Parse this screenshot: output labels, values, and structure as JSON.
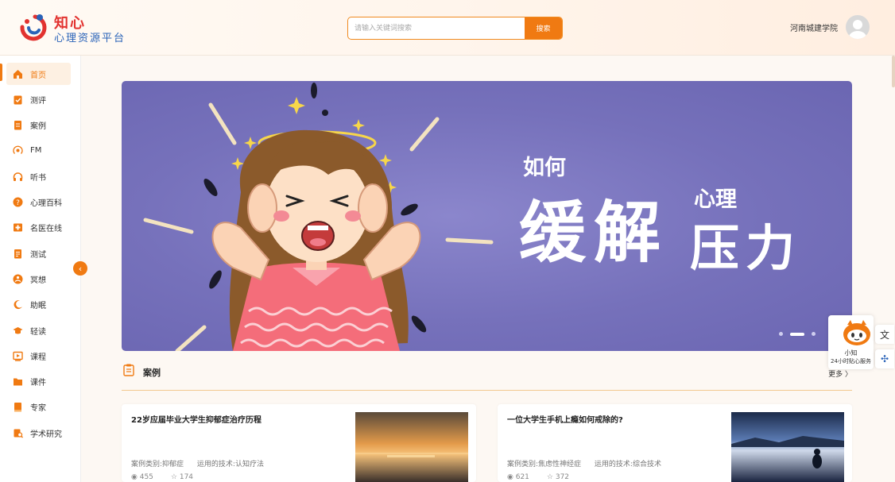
{
  "brand": {
    "title": "知心",
    "subtitle": "心理资源平台"
  },
  "search": {
    "placeholder": "请输入关键词搜索",
    "value": "",
    "button_label": "搜索"
  },
  "user": {
    "name": "河南城建学院"
  },
  "sidebar": {
    "items": [
      {
        "label": "首页",
        "icon": "home-icon",
        "active": true
      },
      {
        "label": "测评",
        "icon": "clipboard-check-icon"
      },
      {
        "label": "案例",
        "icon": "document-icon"
      },
      {
        "label": "FM",
        "icon": "broadcast-icon"
      },
      {
        "label": "听书",
        "icon": "headphones-icon"
      },
      {
        "label": "心理百科",
        "icon": "question-icon"
      },
      {
        "label": "名医在线",
        "icon": "doctor-icon"
      },
      {
        "label": "测试",
        "icon": "test-paper-icon"
      },
      {
        "label": "冥想",
        "icon": "meditation-icon"
      },
      {
        "label": "助眠",
        "icon": "moon-icon"
      },
      {
        "label": "轻读",
        "icon": "graduation-cap-icon"
      },
      {
        "label": "课程",
        "icon": "video-course-icon"
      },
      {
        "label": "课件",
        "icon": "folder-icon"
      },
      {
        "label": "专家",
        "icon": "book-icon"
      },
      {
        "label": "学术研究",
        "icon": "research-icon"
      }
    ]
  },
  "banner": {
    "line1": "如何",
    "line2_big": "缓解",
    "line2_small": "心理",
    "line3": "压力",
    "slides": 3,
    "active_slide": 2
  },
  "section": {
    "title": "案例",
    "more_label": "更多 〉"
  },
  "cases": [
    {
      "title": "22岁应届毕业大学生抑郁症治疗历程",
      "category": "案例类别:抑郁症",
      "technique": "运用的技术:认知疗法",
      "views": "455",
      "stars": "174"
    },
    {
      "title": "一位大学生手机上瘾如何戒除的?",
      "category": "案例类别:焦虑性神经症",
      "technique": "运用的技术:综合技术",
      "views": "621",
      "stars": "372"
    }
  ],
  "assistant": {
    "name": "小知",
    "desc": "24小时贴心服务"
  },
  "colors": {
    "accent": "#f07a12",
    "brand_red": "#e2322f",
    "brand_blue": "#2a63b8",
    "banner_bg": "#7671bb"
  }
}
